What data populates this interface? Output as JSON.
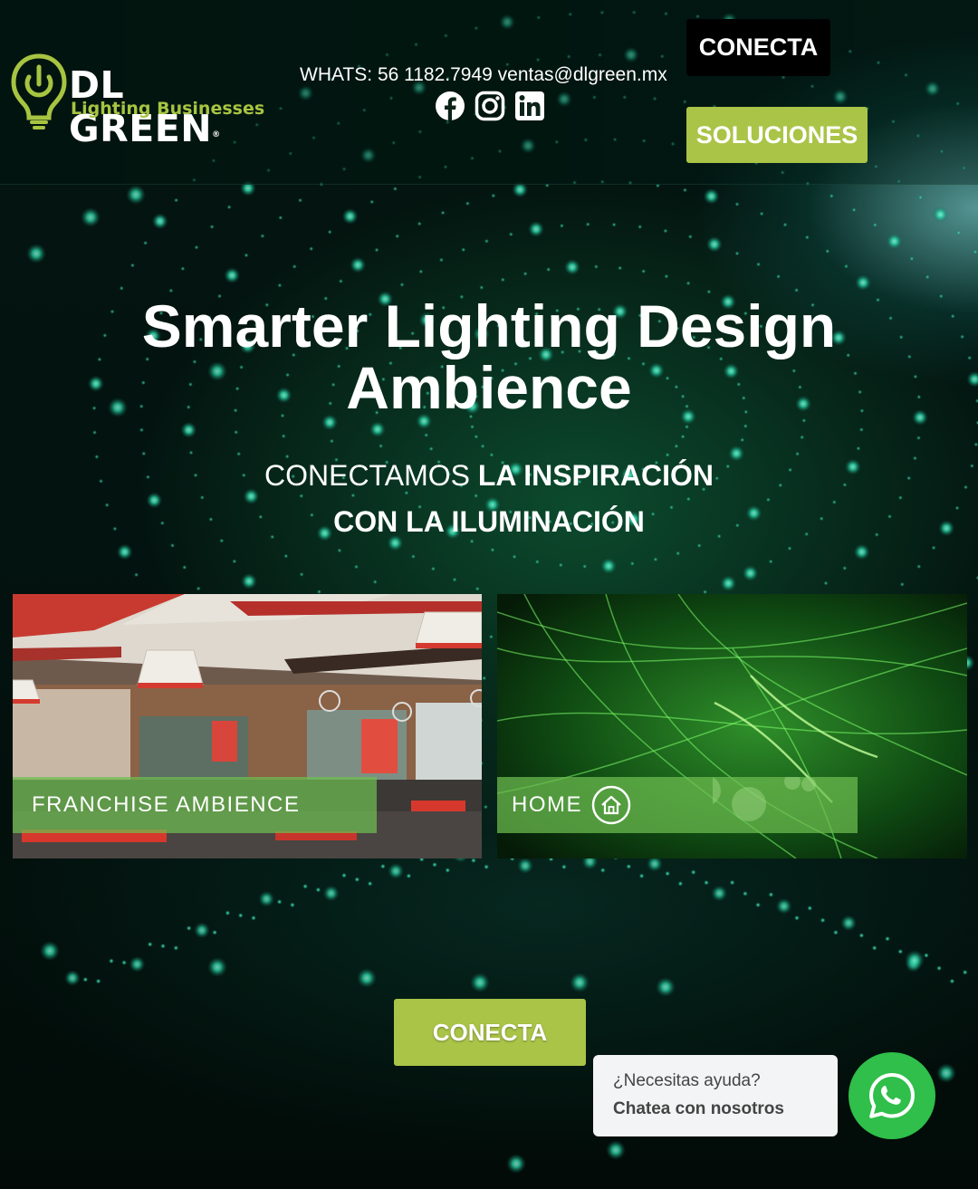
{
  "header": {
    "logo": {
      "name": "DL GREEN",
      "tagline": "Lighting Businesses",
      "registered": "®"
    },
    "contact_text": "WHATS: 56 1182.7949 ventas@dlgreen.mx",
    "socials": [
      {
        "icon": "facebook-icon"
      },
      {
        "icon": "instagram-icon"
      },
      {
        "icon": "linkedin-icon"
      }
    ],
    "buttons": {
      "conecta": "CONECTA",
      "soluciones": "SOLUCIONES"
    }
  },
  "hero": {
    "title_line1": "Smarter Lighting Design",
    "title_line2": "Ambience",
    "sub_light": "CONECTAMOS ",
    "sub_bold1": "LA INSPIRACIÓN",
    "sub_bold2": "CON LA ILUMINACIÓN"
  },
  "cards": {
    "franchise": {
      "label": "FRANCHISE AMBIENCE"
    },
    "home": {
      "label": "HOME",
      "icon": "home-icon"
    }
  },
  "cta": {
    "conecta": "CONECTA"
  },
  "chat": {
    "question": "¿Necesitas ayuda?",
    "action": "Chatea con nosotros",
    "icon": "whatsapp-icon"
  },
  "colors": {
    "accent_green": "#a9c447",
    "whatsapp_green": "#2fbf4a",
    "logo_green": "#a7c441"
  }
}
